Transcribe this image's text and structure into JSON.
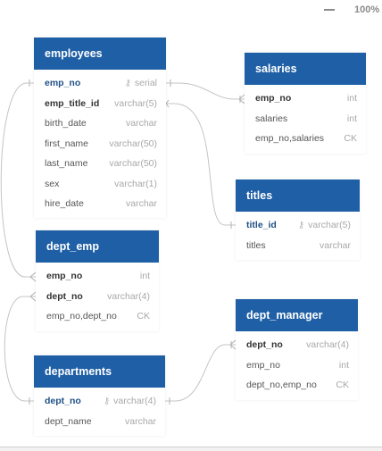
{
  "toolbar": {
    "zoom": "100%"
  },
  "tables": {
    "employees": {
      "title": "employees",
      "fields": [
        {
          "name": "emp_no",
          "type": "serial",
          "key": true
        },
        {
          "name": "emp_title_id",
          "type": "varchar(5)"
        },
        {
          "name": "birth_date",
          "type": "varchar"
        },
        {
          "name": "first_name",
          "type": "varchar(50)"
        },
        {
          "name": "last_name",
          "type": "varchar(50)"
        },
        {
          "name": "sex",
          "type": "varchar(1)"
        },
        {
          "name": "hire_date",
          "type": "varchar"
        }
      ]
    },
    "salaries": {
      "title": "salaries",
      "fields": [
        {
          "name": "emp_no",
          "type": "int"
        },
        {
          "name": "salaries",
          "type": "int"
        },
        {
          "name": "emp_no,salaries",
          "type": "CK"
        }
      ]
    },
    "titles": {
      "title": "titles",
      "fields": [
        {
          "name": "title_id",
          "type": "varchar(5)",
          "key": true
        },
        {
          "name": "titles",
          "type": "varchar"
        }
      ]
    },
    "dept_emp": {
      "title": "dept_emp",
      "fields": [
        {
          "name": "emp_no",
          "type": "int"
        },
        {
          "name": "dept_no",
          "type": "varchar(4)"
        },
        {
          "name": "emp_no,dept_no",
          "type": "CK"
        }
      ]
    },
    "departments": {
      "title": "departments",
      "fields": [
        {
          "name": "dept_no",
          "type": "varchar(4)",
          "key": true
        },
        {
          "name": "dept_name",
          "type": "varchar"
        }
      ]
    },
    "dept_manager": {
      "title": "dept_manager",
      "fields": [
        {
          "name": "dept_no",
          "type": "varchar(4)"
        },
        {
          "name": "emp_no",
          "type": "int"
        },
        {
          "name": "dept_no,emp_no",
          "type": "CK"
        }
      ]
    }
  }
}
